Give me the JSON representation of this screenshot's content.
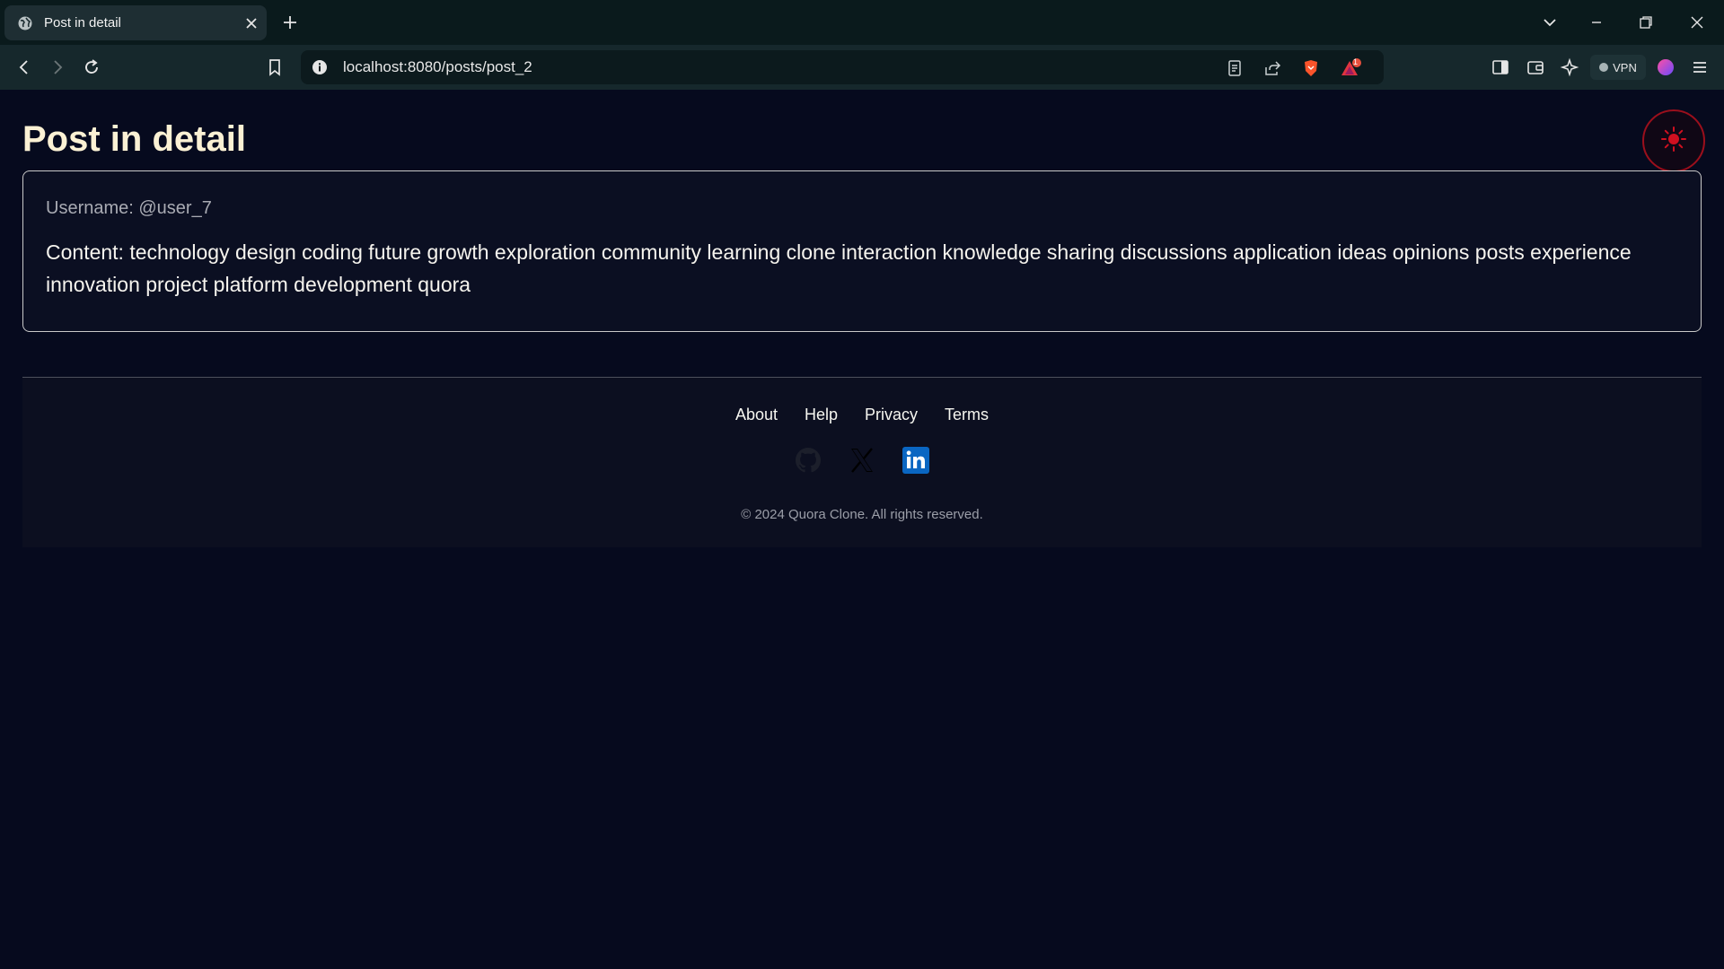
{
  "browser": {
    "tab_title": "Post in detail",
    "url": "localhost:8080/posts/post_2",
    "vpn_label": "VPN",
    "notification_count": "1"
  },
  "page": {
    "title": "Post in detail"
  },
  "post": {
    "username": "Username: @user_7",
    "content": "Content: technology design coding future growth exploration community learning clone interaction knowledge sharing discussions application ideas opinions posts experience innovation project platform development quora"
  },
  "footer": {
    "links": [
      "About",
      "Help",
      "Privacy",
      "Terms"
    ],
    "social": [
      "github-icon",
      "x-icon",
      "linkedin-icon"
    ],
    "copyright": "© 2024 Quora Clone. All rights reserved."
  },
  "colors": {
    "background": "#060a1e",
    "title": "#fbf1d4",
    "toggle_accent": "#d01020",
    "linkedin": "#0a66c2"
  }
}
